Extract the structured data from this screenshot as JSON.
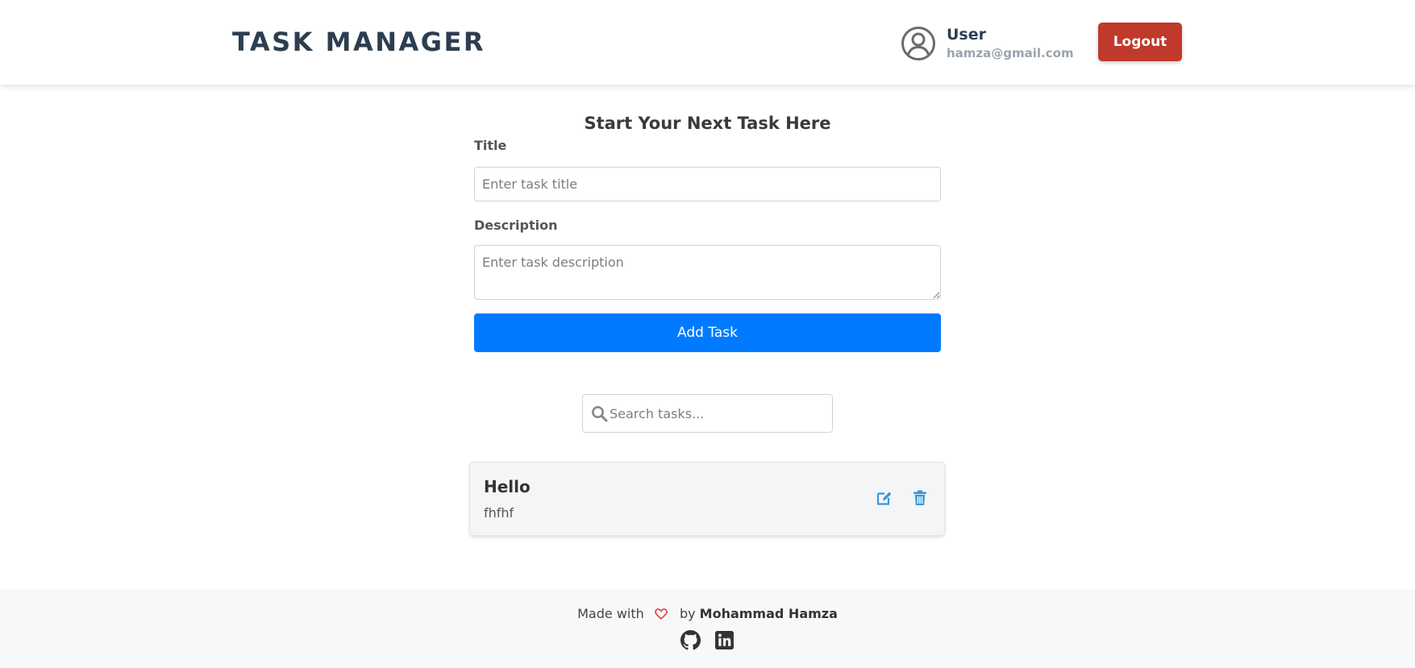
{
  "header": {
    "brand": "TASK MANAGER",
    "user": {
      "name": "User",
      "email": "hamza@gmail.com",
      "avatar_icon": "user-circle-icon"
    },
    "logout_label": "Logout"
  },
  "form": {
    "heading": "Start Your Next Task Here",
    "title_label": "Title",
    "title_value": "",
    "title_placeholder": "Enter task title",
    "description_label": "Description",
    "description_value": "",
    "description_placeholder": "Enter task description",
    "submit_label": "Add Task"
  },
  "search": {
    "value": "",
    "placeholder": "Search tasks...",
    "icon": "search-icon"
  },
  "tasks": [
    {
      "title": "Hello",
      "description": "fhfhf",
      "actions": [
        "edit-icon",
        "trash-icon"
      ]
    }
  ],
  "footer": {
    "made_with": "Made with",
    "heart_icon": "heart-icon",
    "by": "by",
    "author": "Mohammad Hamza",
    "social": [
      "github-icon",
      "linkedin-icon"
    ]
  },
  "colors": {
    "brand_text": "#2c3e50",
    "logout_bg": "#c0392b",
    "primary": "#007bff",
    "action_icon": "#3498db",
    "heart": "#e74c3c",
    "footer_bg": "#f7f8fa"
  }
}
